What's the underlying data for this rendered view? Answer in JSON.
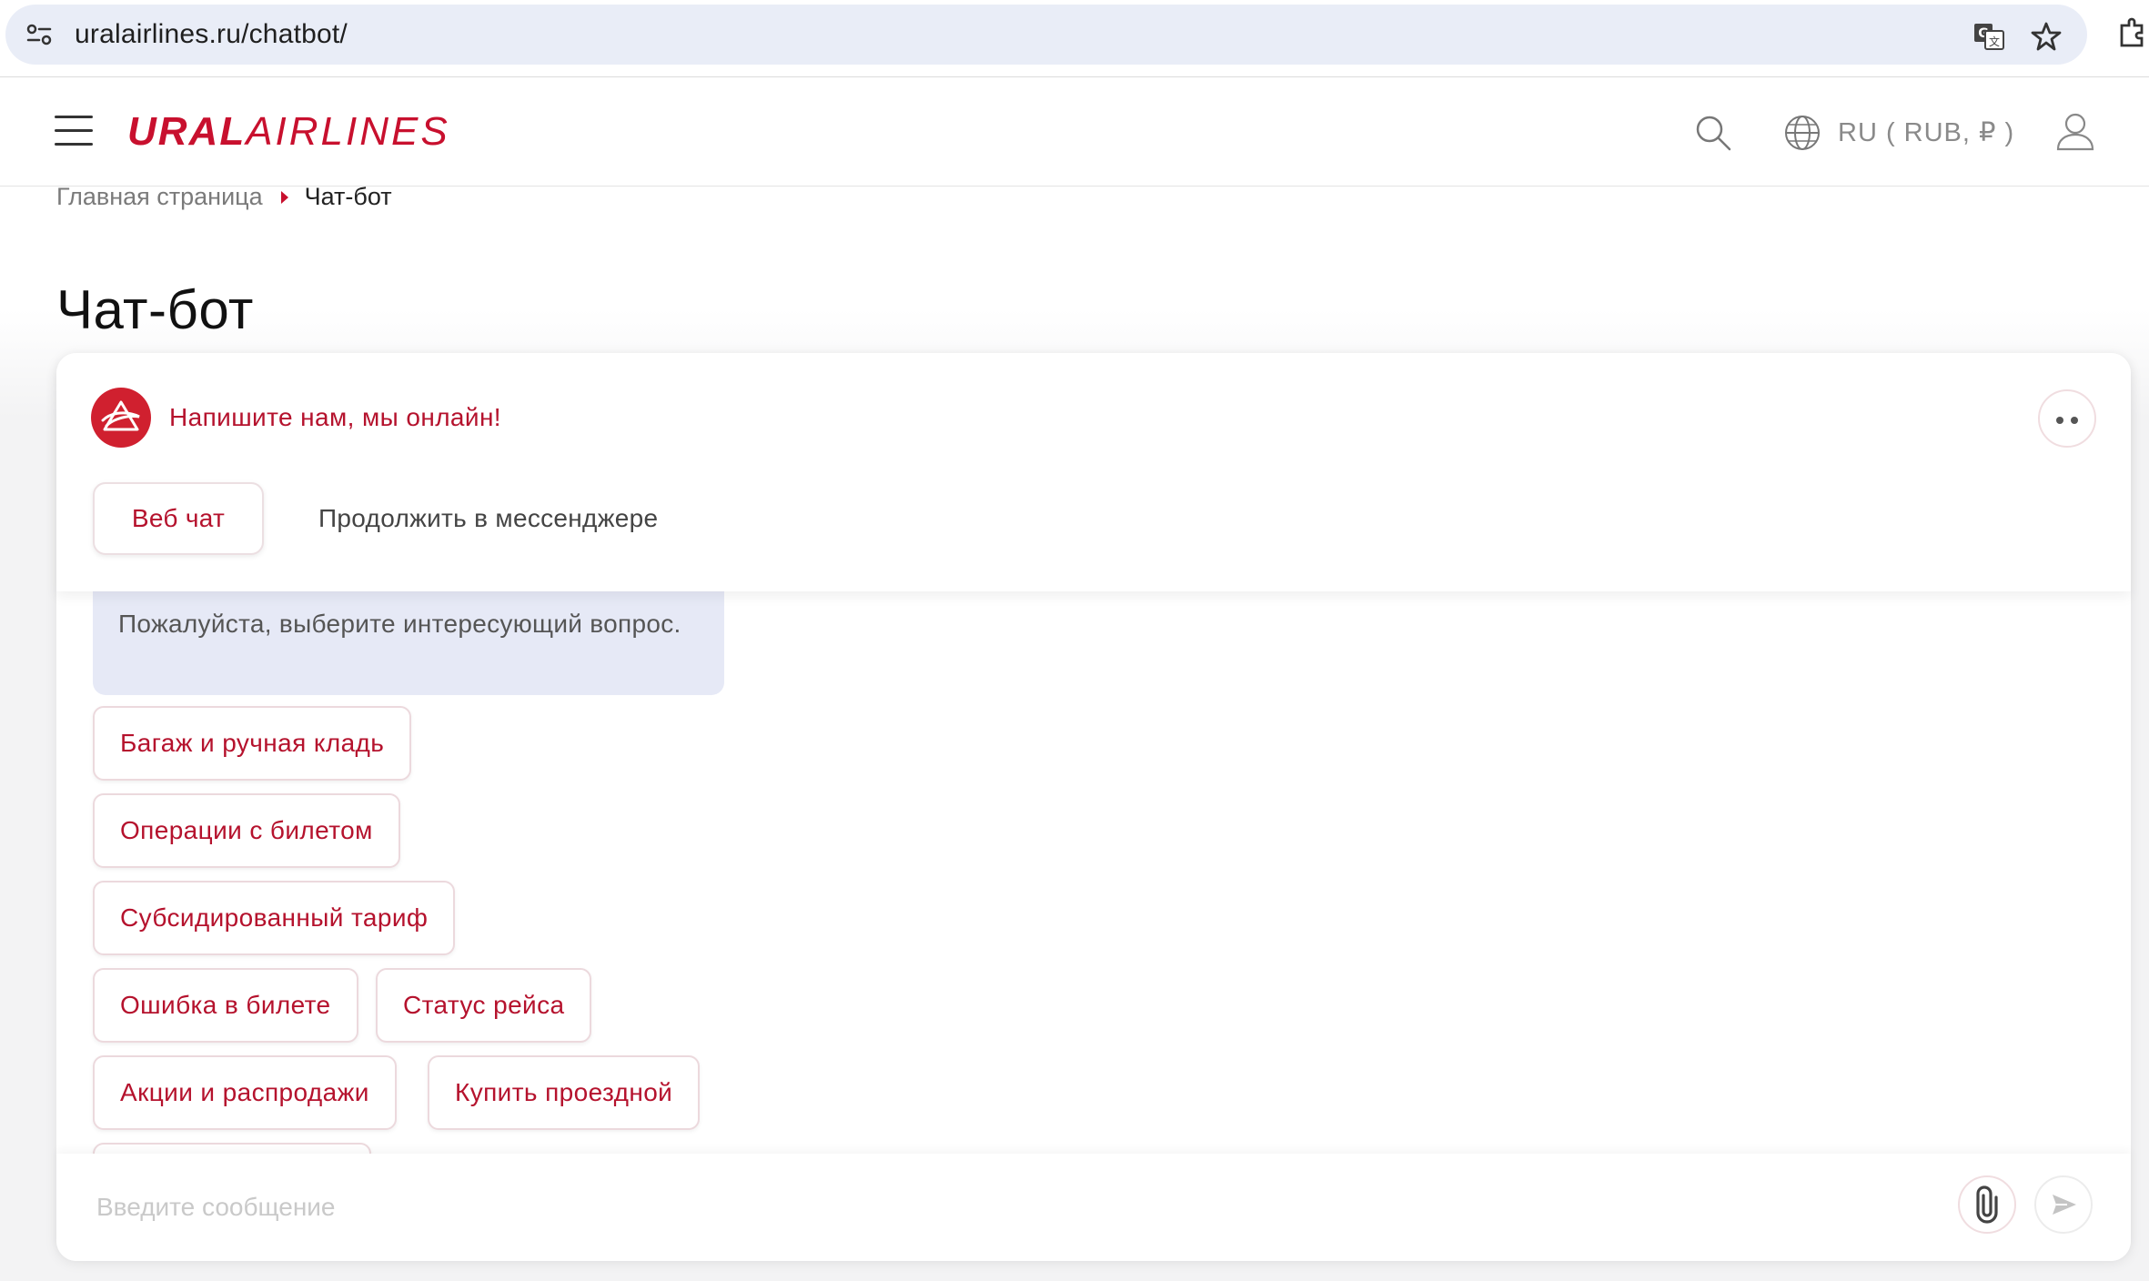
{
  "browser": {
    "url": "uralairlines.ru/chatbot/",
    "icons": [
      "site-info-icon",
      "translate-icon",
      "star-icon",
      "extension-icon"
    ]
  },
  "header": {
    "logo_bold": "URAL",
    "logo_light": "AIRLINES",
    "language": "RU ( RUB, ₽ )",
    "icons": [
      "menu-icon",
      "search-icon",
      "globe-icon",
      "user-icon"
    ]
  },
  "breadcrumb": {
    "home": "Главная страница",
    "current": "Чат-бот"
  },
  "page": {
    "title": "Чат-бот"
  },
  "chat": {
    "status": "Напишите нам, мы онлайн!",
    "tabs": {
      "web": "Веб чат",
      "messenger": "Продолжить в мессенджере"
    },
    "bot_message": "Пожалуйста, выберите интересующий вопрос.",
    "quick_replies": [
      "Багаж и ручная кладь",
      "Операции с билетом",
      "Субсидированный тариф",
      "Ошибка в билете",
      "Статус рейса",
      "Акции и распродажи",
      "Купить проездной"
    ],
    "input": {
      "placeholder": "Введите сообщение",
      "value": ""
    }
  },
  "colors": {
    "brand_red": "#c8102e",
    "text_red": "#b5122d",
    "bot_bubble": "#e6e9f6",
    "address_bar": "#e9edf7"
  }
}
